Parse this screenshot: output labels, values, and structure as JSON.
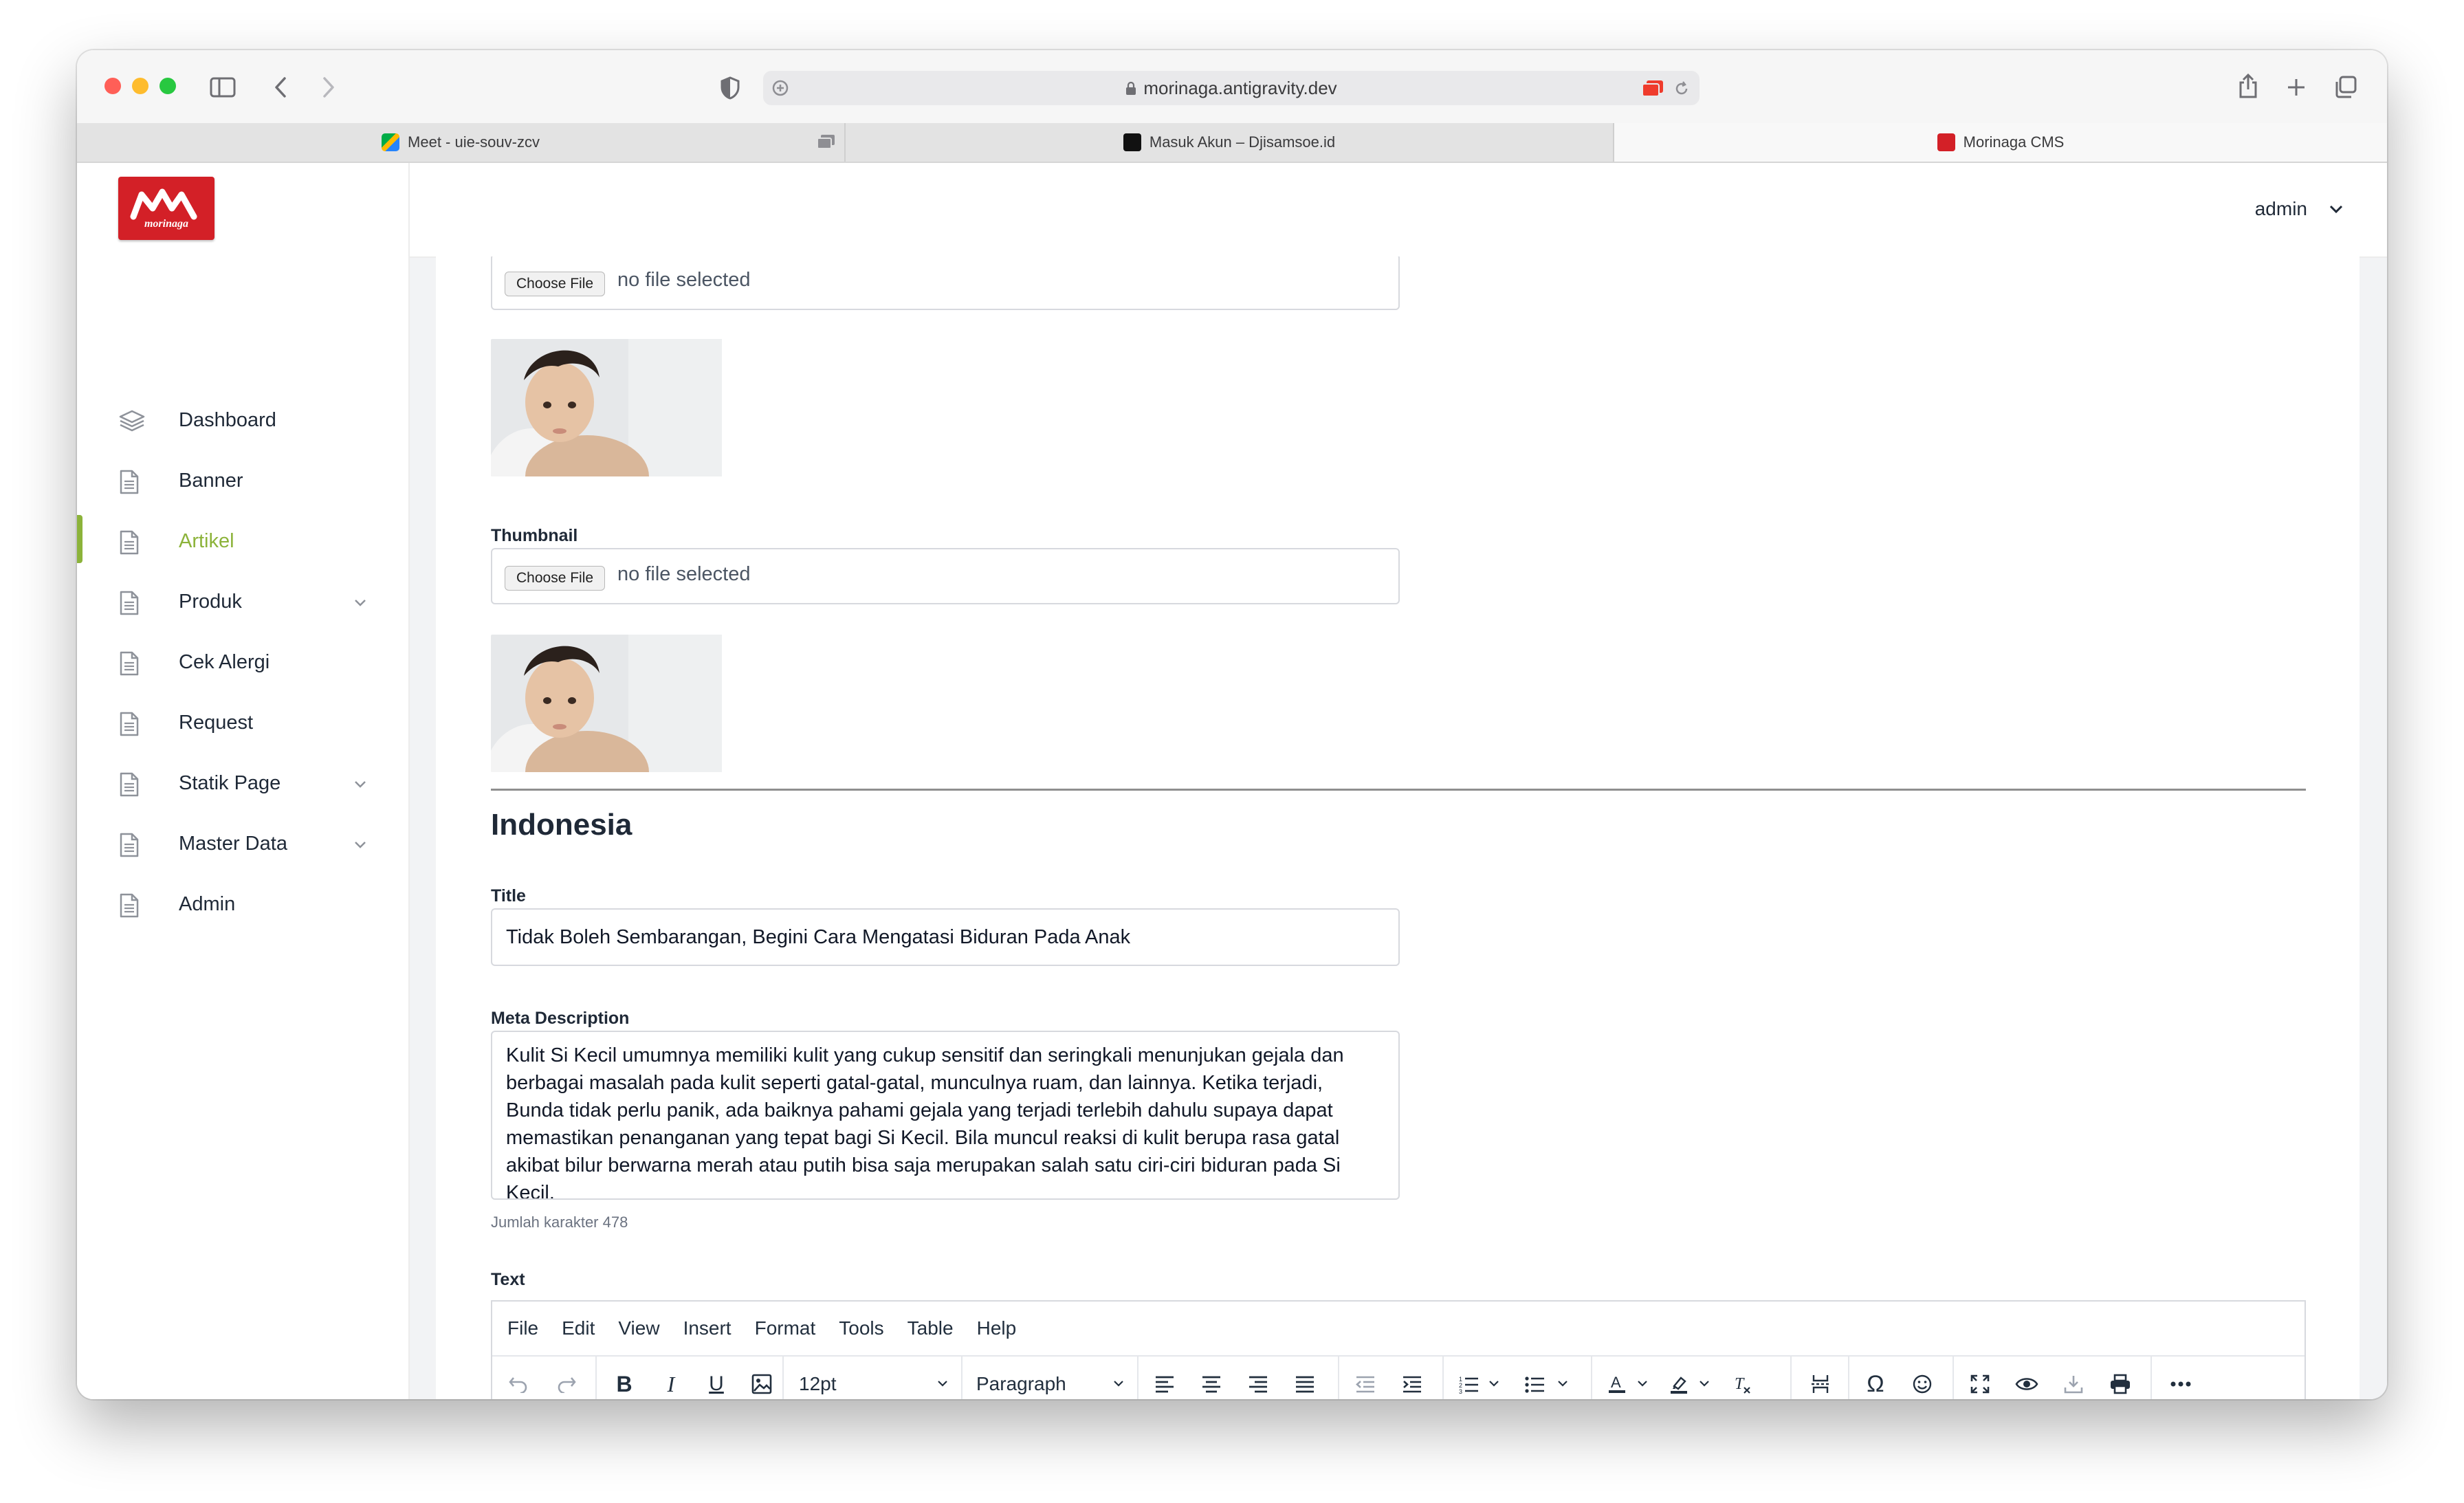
{
  "browser": {
    "url": "morinaga.antigravity.dev",
    "tabs": [
      {
        "title": "Meet - uie-souv-zcv"
      },
      {
        "title": "Masuk Akun – Djisamsoe.id"
      },
      {
        "title": "Morinaga CMS"
      }
    ]
  },
  "brand": {
    "logo_text": "morinaga",
    "color": "#d32027"
  },
  "sidebar": {
    "accent_color": "#8cb33a",
    "items": [
      {
        "label": "Dashboard",
        "icon": "layers-icon"
      },
      {
        "label": "Banner",
        "icon": "document-icon"
      },
      {
        "label": "Artikel",
        "icon": "document-icon",
        "active": true
      },
      {
        "label": "Produk",
        "icon": "document-icon",
        "has_submenu": true
      },
      {
        "label": "Cek Alergi",
        "icon": "document-icon"
      },
      {
        "label": "Request",
        "icon": "document-icon"
      },
      {
        "label": "Statik Page",
        "icon": "document-icon",
        "has_submenu": true
      },
      {
        "label": "Master Data",
        "icon": "document-icon",
        "has_submenu": true
      },
      {
        "label": "Admin",
        "icon": "document-icon"
      }
    ]
  },
  "header": {
    "user_name": "admin"
  },
  "form": {
    "image_upload": {
      "button": "Choose File",
      "status": "no file selected"
    },
    "thumbnail": {
      "label": "Thumbnail",
      "button": "Choose File",
      "status": "no file selected"
    },
    "section_title": "Indonesia",
    "title": {
      "label": "Title",
      "value": "Tidak Boleh Sembarangan, Begini Cara Mengatasi Biduran Pada Anak"
    },
    "meta_description": {
      "label": "Meta Description",
      "value": "Kulit Si Kecil umumnya memiliki kulit yang cukup sensitif dan seringkali menunjukan gejala dan berbagai masalah pada kulit seperti gatal-gatal, munculnya ruam, dan lainnya. Ketika terjadi, Bunda tidak perlu panik, ada baiknya pahami gejala yang terjadi terlebih dahulu supaya dapat memastikan penanganan yang tepat bagi Si Kecil. Bila muncul reaksi di kulit berupa rasa gatal akibat bilur berwarna merah atau putih bisa saja merupakan salah satu ciri-ciri biduran pada Si Kecil.",
      "char_count": "Jumlah karakter 478"
    },
    "text": {
      "label": "Text",
      "menu": [
        "File",
        "Edit",
        "View",
        "Insert",
        "Format",
        "Tools",
        "Table",
        "Help"
      ],
      "font_size": "12pt",
      "block_format": "Paragraph"
    }
  }
}
